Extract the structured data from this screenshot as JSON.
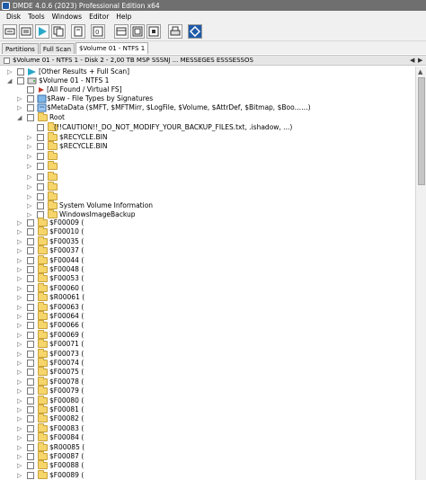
{
  "window": {
    "title": "DMDE 4.0.6 (2023) Professional Edition x64"
  },
  "menu": [
    "Disk",
    "Tools",
    "Windows",
    "Editor",
    "Help"
  ],
  "toolbar": {
    "buttons": [
      {
        "name": "disk-icon"
      },
      {
        "name": "list-icon"
      },
      {
        "name": "play-icon"
      },
      {
        "name": "copy-icon"
      },
      {
        "name": "file-icon"
      },
      {
        "name": "edit-icon"
      },
      {
        "name": "view-icon"
      },
      {
        "name": "select-icon"
      },
      {
        "name": "print-icon"
      },
      {
        "name": "brand-icon"
      }
    ]
  },
  "tabs": [
    "Partitions",
    "Full Scan",
    "$Volume 01 - NTFS 1"
  ],
  "pathbar": {
    "text": "$Volume 01 - NTFS 1 - Disk 2 - 2,00 TB  MSP  SSSNJ ... MESSEGES  ESSSESSOS"
  },
  "tree": {
    "top_rows": [
      {
        "label": "[Other Results + Full Scan]"
      },
      {
        "label": "$Volume 01 - NTFS 1"
      },
      {
        "label": "[All Found / Virtual FS]"
      },
      {
        "label": "$Raw - File Types by Signatures"
      },
      {
        "label": "$MetaData ($MFT, $MFTMirr, $LogFile, $Volume, $AttrDef, $Bitmap, $Boo……)"
      },
      {
        "label": "Root"
      },
      {
        "label": "(!!CAUTION!!_DO_NOT_MODIFY_YOUR_BACKUP_FILES.txt, .ishadow, ...)"
      },
      {
        "label": "$RECYCLE.BIN"
      },
      {
        "label": "$RECYCLE.BIN"
      },
      {
        "label": ""
      },
      {
        "label": ""
      },
      {
        "label": ""
      },
      {
        "label": ""
      },
      {
        "label": ""
      },
      {
        "label": "System Volume Information"
      },
      {
        "label": "WindowsImageBackup"
      }
    ],
    "f_rows": [
      "$F00009 (",
      "$F00010 (",
      "$F00035 (",
      "$F00037 (",
      "$F00044 (",
      "$F00048 (",
      "$F00053 (",
      "$F00060 (",
      "$R00061 (",
      "$F00063 (",
      "$F00064 (",
      "$F00066 (",
      "$F00069 (",
      "$F00071 (",
      "$F00073 (",
      "$F00074 (",
      "$F00075 (",
      "$F00078 (",
      "$F00079 (",
      "$F00080 (",
      "$F00081 (",
      "$F00082 (",
      "$F00083 (",
      "$F00084 (",
      "$R00085 (",
      "$F00087 (",
      "$F00088 (",
      "$F00089 ("
    ]
  }
}
